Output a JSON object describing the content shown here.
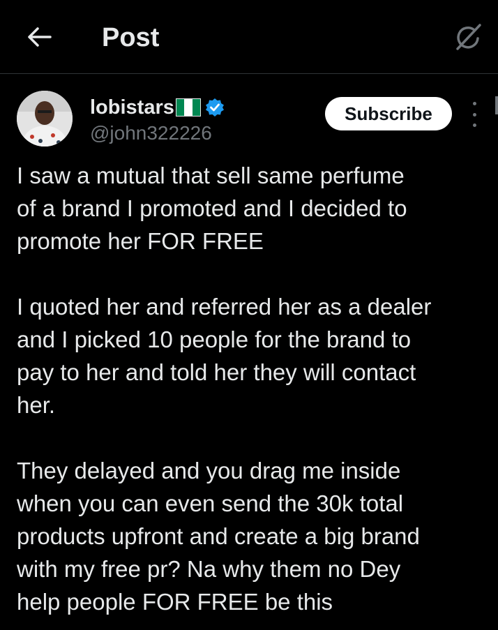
{
  "header": {
    "title": "Post",
    "back_icon": "arrow-left-icon",
    "grok_icon": "grok-icon"
  },
  "author": {
    "name": "lobistars",
    "flag": "nigeria-flag",
    "verified_color": "#1d9bf0",
    "handle": "@john322226"
  },
  "actions": {
    "subscribe_label": "Subscribe",
    "more_icon": "more-vertical-icon"
  },
  "tweet": {
    "paragraphs": [
      "I saw a mutual that sell same perfume\nof a brand I promoted and I decided to\npromote her FOR FREE",
      "I quoted her and referred her as a dealer\nand I picked 10 people for the brand to\npay to her and told her they will contact\nher.",
      "They delayed and you drag me inside\nwhen you can even send the 30k total\nproducts upfront and create a big brand\nwith my free pr? Na why them no Dey\nhelp people FOR FREE be this"
    ]
  },
  "colors": {
    "background": "#000000",
    "text": "#e7e9ea",
    "secondary": "#71767b",
    "divider": "#2f3336",
    "flag_green": "#008751",
    "flag_white": "#ffffff"
  }
}
